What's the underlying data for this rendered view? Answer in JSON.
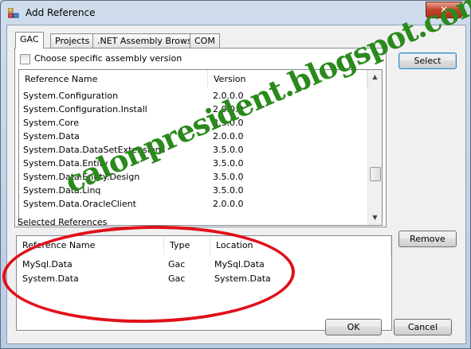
{
  "window": {
    "title": "Add Reference",
    "close_label": "✕"
  },
  "tabs": [
    {
      "label": "GAC",
      "active": true
    },
    {
      "label": "Projects",
      "active": false
    },
    {
      "label": ".NET Assembly Browser",
      "active": false
    },
    {
      "label": "COM",
      "active": false
    }
  ],
  "gac": {
    "specific_version_label": "Choose specific assembly version",
    "columns": {
      "name": "Reference Name",
      "version": "Version"
    },
    "rows": [
      {
        "name": "System.Configuration",
        "version": "2.0.0.0"
      },
      {
        "name": "System.Configuration.Install",
        "version": "2.0.0.0"
      },
      {
        "name": "System.Core",
        "version": "3.5.0.0"
      },
      {
        "name": "System.Data",
        "version": "2.0.0.0"
      },
      {
        "name": "System.Data.DataSetExtensions",
        "version": "3.5.0.0"
      },
      {
        "name": "System.Data.Entity",
        "version": "3.5.0.0"
      },
      {
        "name": "System.Data.Entity.Design",
        "version": "3.5.0.0"
      },
      {
        "name": "System.Data.Linq",
        "version": "3.5.0.0"
      },
      {
        "name": "System.Data.OracleClient",
        "version": "2.0.0.0"
      }
    ]
  },
  "buttons": {
    "select": "Select",
    "remove": "Remove",
    "ok": "OK",
    "cancel": "Cancel"
  },
  "selected": {
    "label": "Selected References",
    "columns": {
      "name": "Reference Name",
      "type": "Type",
      "location": "Location"
    },
    "rows": [
      {
        "name": "MySql.Data",
        "type": "Gac",
        "location": "MySql.Data"
      },
      {
        "name": "System.Data",
        "type": "Gac",
        "location": "System.Data"
      }
    ]
  },
  "watermark": "calonpresident.blogspot.com",
  "colors": {
    "watermark": "#2a8a1c",
    "annotation_circle": "#e0101a",
    "close_button": "#c4412a"
  },
  "icons": {
    "app": "add-reference-icon",
    "close": "close-icon"
  }
}
